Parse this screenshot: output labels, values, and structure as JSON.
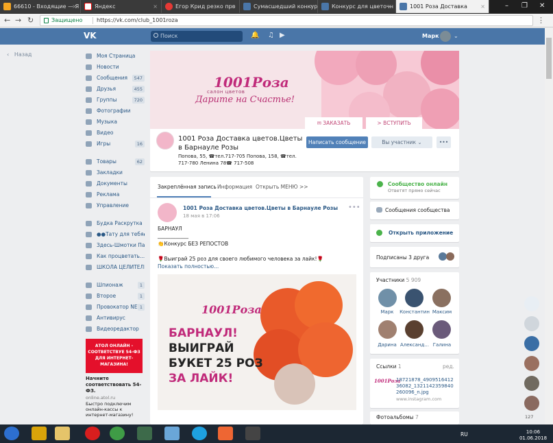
{
  "browser": {
    "tabs": [
      {
        "label": "66610 - Входящие — Я",
        "color": "#f5a623"
      },
      {
        "label": "Яндекс",
        "color": "#ffffff"
      },
      {
        "label": "Егор Крид резко про",
        "color": "#e53935"
      },
      {
        "label": "Сумасшедший конкур",
        "color": "#4a76a8"
      },
      {
        "label": "Конкурс для цветочн",
        "color": "#4a76a8"
      },
      {
        "label": "1001 Роза Доставка",
        "color": "#4a76a8"
      }
    ],
    "secure_label": "Защищено",
    "url": "https://vk.com/club_1001roza"
  },
  "vk_header": {
    "logo": "VK",
    "search_placeholder": "Поиск",
    "user_name": "Марк"
  },
  "left_menu": {
    "back": "Назад",
    "items": [
      {
        "label": "Моя Страница",
        "count": ""
      },
      {
        "label": "Новости",
        "count": ""
      },
      {
        "label": "Сообщения",
        "count": "547"
      },
      {
        "label": "Друзья",
        "count": "455"
      },
      {
        "label": "Группы",
        "count": "720"
      },
      {
        "label": "Фотографии",
        "count": ""
      },
      {
        "label": "Музыка",
        "count": ""
      },
      {
        "label": "Видео",
        "count": ""
      },
      {
        "label": "Игры",
        "count": "16"
      }
    ],
    "items2": [
      {
        "label": "Товары",
        "count": "62"
      },
      {
        "label": "Закладки",
        "count": ""
      },
      {
        "label": "Документы",
        "count": ""
      },
      {
        "label": "Реклама",
        "count": ""
      },
      {
        "label": "Управление",
        "count": ""
      }
    ],
    "items3": [
      {
        "label": "Будка Раскрутка",
        "count": ""
      },
      {
        "label": "●●Тату для тебя●●",
        "count": ""
      },
      {
        "label": "Здесь-Шмотки Па...",
        "count": ""
      },
      {
        "label": "Как процветать...",
        "count": ""
      },
      {
        "label": "ШКОЛА ЦЕЛИТЕЛЬ...",
        "count": ""
      }
    ],
    "items4": [
      {
        "label": "Шпионаж",
        "count": "1"
      },
      {
        "label": "Второе",
        "count": "1"
      },
      {
        "label": "Провокатор NEW",
        "count": "1"
      },
      {
        "label": "Антивирус",
        "count": ""
      },
      {
        "label": "Видеоредактор",
        "count": ""
      }
    ],
    "ad": {
      "image_text": "АТОЛ ОНЛАЙН - СООТВЕТСТВУЕ 54-ФЗ ДЛЯ ИНТЕРНЕТ-МАГАЗИНА!",
      "title": "Начните соответствовать 54-ФЗ.",
      "host": "online.atol.ru",
      "text": "Быстро подключим онлайн-кассы к интернет-магазину!"
    }
  },
  "group": {
    "logo_text": "1001Роза",
    "logo_sub": "салон цветов",
    "slogan": "Дарите на Счастье!",
    "cover_btn_order": "ЗАКАЗАТЬ",
    "cover_btn_join": "ВСТУПИТЬ",
    "name": "1001 Роза Доставка цветов.Цветы в Барнауле Розы",
    "status": "Попова, 55, ☎тел.717-705 Попова, 158, ☎тел. 717-780 Ленина 78☎ 717-508",
    "btn_message": "Написать сообщение",
    "btn_member": "Вы участник",
    "btn_more": "•••"
  },
  "wall": {
    "tabs": [
      "Закреплённая запись",
      "Информация",
      "Открыть МЕНЮ >>"
    ],
    "post": {
      "author": "1001 Роза Доставка цветов.Цветы в Барнауле Розы",
      "date": "18 мая в 17:06",
      "lines": [
        "БАРНАУЛ",
        "____________",
        "👏Конкурс БЕЗ РЕПОСТОВ",
        "🌹Выиграй 25 роз для своего любимого человека за лайк!🌹"
      ],
      "show_more": "Показать полностью...",
      "image_brand": "1001Роза",
      "image_h1": "БАРНАУЛ!",
      "image_h2": "ВЫИГРАЙ",
      "image_h3": "БУКЕТ 25 РОЗ",
      "image_h4": "ЗА ЛАЙК!"
    }
  },
  "right": {
    "online_title": "Сообщество онлайн",
    "online_sub": "Ответят прямо сейчас",
    "messages": "Сообщения сообщества",
    "open_app": "Открыть приложение",
    "subscribed": "Подписаны 3 друга",
    "members_label": "Участники",
    "members_count": "5 909",
    "members": [
      "Марк",
      "Константин",
      "Максим",
      "Дарина",
      "Александ...",
      "Галина"
    ],
    "links_label": "Ссылки",
    "links_count": "1",
    "links_edit": "ред.",
    "link_title": "18721878_490951641236082_1321142359840260096_n.jpg",
    "link_host": "www.instagram.com",
    "albums_label": "Фотоальбомы",
    "albums_count": "7"
  },
  "rbar": {
    "counter": "127"
  },
  "taskbar": {
    "lang": "RU",
    "time": "10:06",
    "date": "01.06.2018"
  }
}
